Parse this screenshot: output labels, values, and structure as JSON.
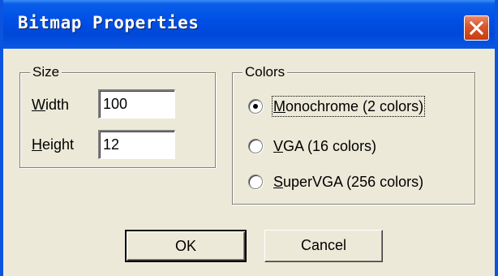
{
  "dialog": {
    "title": "Bitmap Properties"
  },
  "size_group": {
    "label": "Size",
    "width": {
      "mnemonic": "W",
      "rest": "idth",
      "value": "100"
    },
    "height": {
      "mnemonic": "H",
      "rest": "eight",
      "value": "12"
    }
  },
  "colors_group": {
    "label": "Colors",
    "options": [
      {
        "mnemonic": "M",
        "rest": "onochrome (2 colors)",
        "selected": true
      },
      {
        "mnemonic": "V",
        "rest": "GA (16 colors)",
        "selected": false
      },
      {
        "mnemonic": "S",
        "rest": "uperVGA (256 colors)",
        "selected": false
      }
    ]
  },
  "buttons": {
    "ok": "OK",
    "cancel": "Cancel"
  },
  "icons": {
    "close": "close-icon"
  },
  "colors": {
    "titlebar": "#0050e6",
    "close_button": "#d9582f",
    "dialog_bg": "#ece9d8"
  }
}
